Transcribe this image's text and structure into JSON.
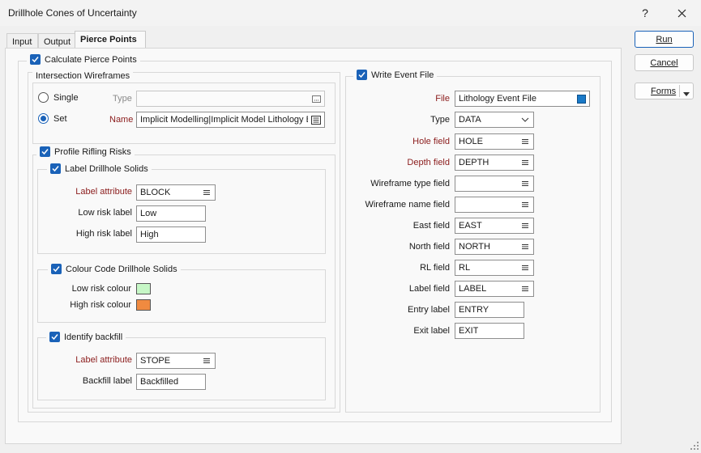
{
  "window": {
    "title": "Drillhole Cones of Uncertainty",
    "help_label": "?",
    "close_label": "✕"
  },
  "tabs": [
    {
      "label": "Input"
    },
    {
      "label": "Output"
    },
    {
      "label": "Pierce Points"
    }
  ],
  "left": {
    "calculate": {
      "label": "Calculate Pierce Points",
      "checked": true
    },
    "intersection": {
      "title": "Intersection Wireframes",
      "single_label": "Single",
      "set_label": "Set",
      "type_label": "Type",
      "type_value": "",
      "name_label": "Name",
      "name_value": "Implicit Modelling|Implicit Model Lithology Bc"
    },
    "profile": {
      "label": "Profile Rifling Risks",
      "checked": true
    },
    "label_solids": {
      "label": "Label Drillhole Solids",
      "attr_label": "Label attribute",
      "attr_value": "BLOCK",
      "low_label": "Low risk label",
      "low_value": "Low",
      "high_label": "High risk label",
      "high_value": "High"
    },
    "colour_code": {
      "label": "Colour Code Drillhole Solids",
      "low_label": "Low risk colour",
      "low_color": "#c6f7c6",
      "high_label": "High risk colour",
      "high_color": "#f08a40"
    },
    "backfill": {
      "label": "Identify backfill",
      "attr_label": "Label attribute",
      "attr_value": "STOPE",
      "backfill_label": "Backfill label",
      "backfill_value": "Backfilled"
    }
  },
  "right": {
    "write_event": {
      "label": "Write Event File",
      "checked": true
    },
    "file_label": "File",
    "file_value": "Lithology Event File",
    "file_accent": "#1a7ac8",
    "type_label": "Type",
    "type_value": "DATA",
    "hole_label": "Hole field",
    "hole_value": "HOLE",
    "depth_label": "Depth field",
    "depth_value": "DEPTH",
    "wf_type_label": "Wireframe type field",
    "wf_type_value": "",
    "wf_name_label": "Wireframe name field",
    "wf_name_value": "",
    "east_label": "East field",
    "east_value": "EAST",
    "north_label": "North field",
    "north_value": "NORTH",
    "rl_label": "RL field",
    "rl_value": "RL",
    "labelf_label": "Label field",
    "labelf_value": "LABEL",
    "entry_label": "Entry label",
    "entry_value": "ENTRY",
    "exit_label": "Exit label",
    "exit_value": "EXIT"
  },
  "buttons": {
    "run": "Run",
    "cancel": "Cancel",
    "forms": "Forms"
  },
  "colors": {
    "accent": "#1a62b8",
    "required_label": "#8b1c1c"
  }
}
